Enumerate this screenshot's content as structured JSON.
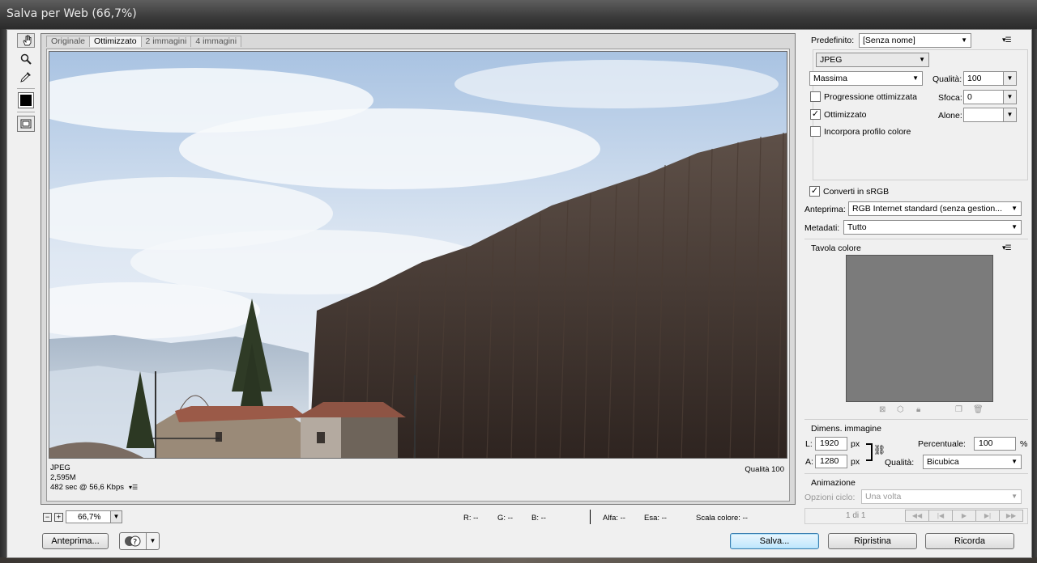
{
  "window": {
    "title": "Salva per Web (66,7%)"
  },
  "tools": [
    {
      "name": "hand-tool-icon",
      "glyph": "✋"
    },
    {
      "name": "slice-select-tool-icon",
      "glyph": "➶"
    },
    {
      "name": "zoom-tool-icon",
      "glyph": "🔍"
    },
    {
      "name": "eyedropper-tool-icon",
      "glyph": "✒"
    }
  ],
  "tabs": [
    "Originale",
    "Ottimizzato",
    "2 immagini",
    "4 immagini"
  ],
  "active_tab": "Ottimizzato",
  "preview_info": {
    "format": "JPEG",
    "size": "2,595M",
    "time": "482 sec @ 56,6 Kbps",
    "quality": "Qualità 100"
  },
  "zoom": {
    "value": "66,7%",
    "minus": "−",
    "plus": "+"
  },
  "readouts": {
    "r": "R: --",
    "g": "G: --",
    "b": "B: --",
    "alpha": "Alfa: --",
    "hex": "Esa: --",
    "color_index": "Scala colore: --"
  },
  "buttons": {
    "preview": "Anteprima...",
    "save": "Salva...",
    "reset": "Ripristina",
    "remember": "Ricorda"
  },
  "settings": {
    "preset_label": "Predefinito:",
    "preset_value": "[Senza nome]",
    "format": "JPEG",
    "quality_level": "Massima",
    "quality_label": "Qualità:",
    "quality_value": "100",
    "progressive_label": "Progressione ottimizzata",
    "progressive_checked": false,
    "blur_label": "Sfoca:",
    "blur_value": "0",
    "optimized_label": "Ottimizzato",
    "optimized_checked": true,
    "matte_label": "Alone:",
    "matte_value": "",
    "embed_profile_label": "Incorpora profilo colore",
    "embed_profile_checked": false,
    "convert_srgb_label": "Converti in sRGB",
    "convert_srgb_checked": true,
    "preview_label": "Anteprima:",
    "preview_value": "RGB Internet standard (senza gestion...",
    "metadata_label": "Metadati:",
    "metadata_value": "Tutto"
  },
  "color_table": {
    "title": "Tavola colore",
    "swatch_color": "#7b7b7b"
  },
  "image_size": {
    "title": "Dimens. immagine",
    "width_label": "L:",
    "width_value": "1920",
    "height_label": "A:",
    "height_value": "1280",
    "unit": "px",
    "percent_label": "Percentuale:",
    "percent_value": "100",
    "percent_unit": "%",
    "quality_label": "Qualità:",
    "quality_value": "Bicubica"
  },
  "animation": {
    "title": "Animazione",
    "loop_label": "Opzioni ciclo:",
    "loop_value": "Una volta",
    "frame_counter": "1 di 1"
  },
  "colors": {
    "accent": "#3c7fb1",
    "panel_bg": "#f0f0f0",
    "sky": "#bcd2ea"
  }
}
